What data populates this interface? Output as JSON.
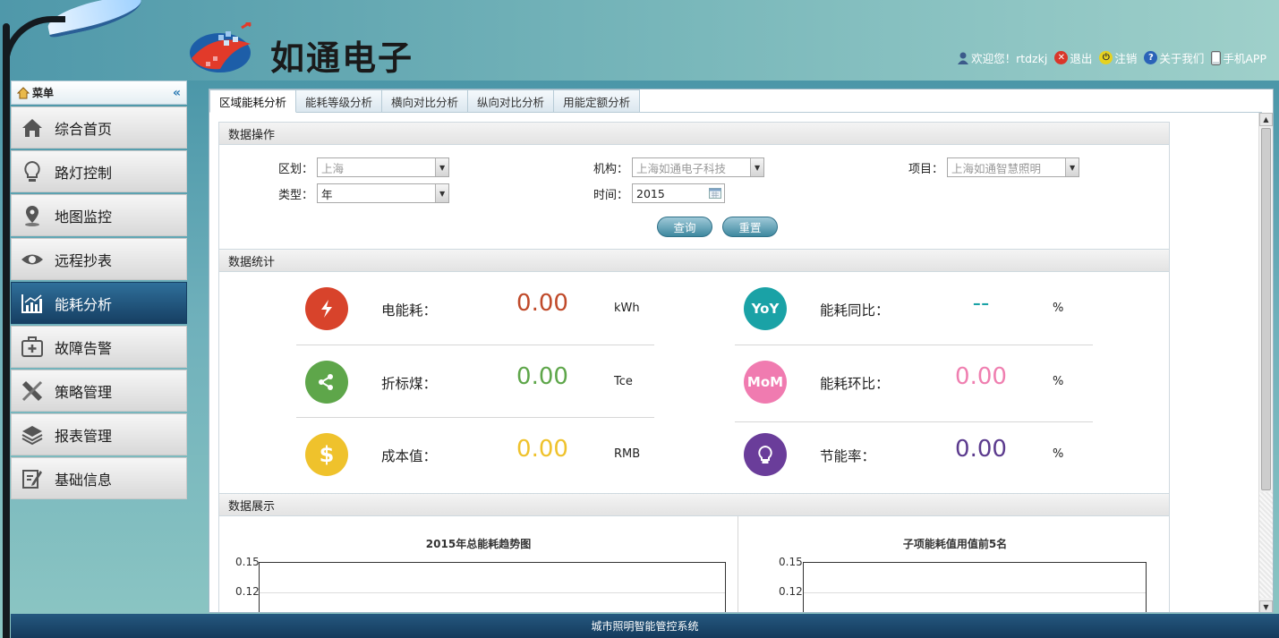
{
  "header": {
    "brand": "如通电子",
    "links": {
      "welcome": "欢迎您！rtdzkj",
      "logout": "退出",
      "signout": "注销",
      "about": "关于我们",
      "app": "手机APP"
    }
  },
  "sidebar": {
    "title": "菜单",
    "collapse": "«",
    "items": [
      {
        "label": "综合首页",
        "icon": "home-icon"
      },
      {
        "label": "路灯控制",
        "icon": "bulb-icon"
      },
      {
        "label": "地图监控",
        "icon": "map-pin-icon"
      },
      {
        "label": "远程抄表",
        "icon": "eye-icon"
      },
      {
        "label": "能耗分析",
        "icon": "chart-icon",
        "active": true
      },
      {
        "label": "故障告警",
        "icon": "first-aid-icon"
      },
      {
        "label": "策略管理",
        "icon": "tools-icon"
      },
      {
        "label": "报表管理",
        "icon": "layers-icon"
      },
      {
        "label": "基础信息",
        "icon": "edit-icon"
      }
    ]
  },
  "tabs": [
    "区域能耗分析",
    "能耗等级分析",
    "横向对比分析",
    "纵向对比分析",
    "用能定额分析"
  ],
  "ops": {
    "title": "数据操作",
    "region": {
      "label": "区划：",
      "value": "上海"
    },
    "org": {
      "label": "机构：",
      "value": "上海如通电子科技"
    },
    "project": {
      "label": "项目：",
      "value": "上海如通智慧照明"
    },
    "type": {
      "label": "类型：",
      "value": "年"
    },
    "time": {
      "label": "时间：",
      "value": "2015"
    },
    "query": "查询",
    "reset": "重置"
  },
  "stats": {
    "title": "数据统计",
    "items": [
      {
        "name": "电能耗：",
        "value": "0.00",
        "unit": "kWh",
        "badge": "⚡",
        "color": "#d8432b",
        "valcolor": "#c04a2a"
      },
      {
        "name": "折标煤：",
        "value": "0.00",
        "unit": "Tce",
        "badge": "share",
        "color": "#5ea64a",
        "valcolor": "#5ea64a"
      },
      {
        "name": "成本值：",
        "value": "0.00",
        "unit": "RMB",
        "badge": "$",
        "color": "#efc22c",
        "valcolor": "#efc22c"
      },
      {
        "name": "能耗同比：",
        "value": "--",
        "unit": "%",
        "badge": "YoY",
        "color": "#1aa2a6",
        "valcolor": "#1aa2a6"
      },
      {
        "name": "能耗环比：",
        "value": "0.00",
        "unit": "%",
        "badge": "MoM",
        "color": "#f07bb0",
        "valcolor": "#ef7fb0"
      },
      {
        "name": "节能率：",
        "value": "0.00",
        "unit": "%",
        "badge": "bulb",
        "color": "#6a3d9a",
        "valcolor": "#5c3b8e"
      }
    ]
  },
  "show": {
    "title": "数据展示",
    "chart1_title": "2015年总能耗趋势图",
    "chart2_title": "子项能耗值用值前5名",
    "ticks": [
      "0.15",
      "0.12"
    ]
  },
  "footer": "城市照明智能管控系统"
}
